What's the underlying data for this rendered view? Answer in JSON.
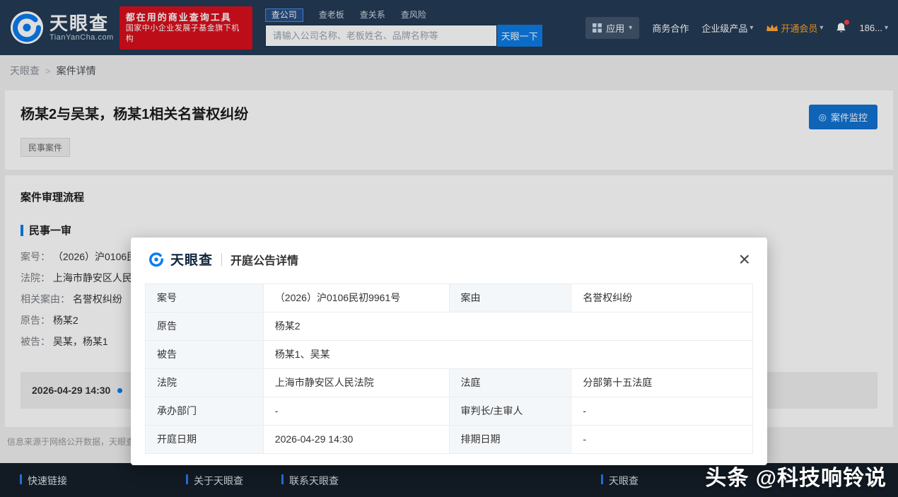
{
  "header": {
    "logo": {
      "brand": "天眼查",
      "domain": "TianYanCha.com"
    },
    "promo_badge": {
      "line1": "都在用的商业查询工具",
      "line2": "国家中小企业发展子基金旗下机构"
    },
    "search_tabs": [
      {
        "label": "查公司",
        "active": true
      },
      {
        "label": "查老板",
        "active": false
      },
      {
        "label": "查关系",
        "active": false
      },
      {
        "label": "查风险",
        "active": false
      }
    ],
    "search": {
      "placeholder": "请输入公司名称、老板姓名、品牌名称等",
      "button_label": "天眼一下"
    },
    "nav": {
      "apps": "应用",
      "business": "商务合作",
      "enterprise": "企业级产品",
      "vip": "开通会员",
      "account": "186..."
    }
  },
  "breadcrumb": {
    "home": "天眼查",
    "separator": ">",
    "current": "案件详情"
  },
  "case": {
    "title": "杨某2与吴某，杨某1相关名誉权纠纷",
    "tag": "民事案件",
    "monitor_button": "案件监控",
    "section_title": "案件审理流程",
    "stage_title": "民事一审",
    "fields": [
      {
        "label": "案号：",
        "value": "（2026）沪0106民"
      },
      {
        "label": "法院：",
        "value": "上海市静安区人民"
      },
      {
        "label": "相关案由：",
        "value": "名誉权纠纷"
      },
      {
        "label": "原告：",
        "value": "杨某2"
      },
      {
        "label": "被告：",
        "value": "吴某，杨某1"
      }
    ],
    "timeline_event": {
      "date": "2026-04-29 14:30"
    },
    "source_note": "信息来源于网络公开数据，天眼查"
  },
  "modal": {
    "brand": "天眼查",
    "title": "开庭公告详情",
    "close_glyph": "×",
    "table": {
      "rows": [
        {
          "label1": "案号",
          "value1": "（2026）沪0106民初9961号",
          "label2": "案由",
          "value2": "名誉权纠纷"
        },
        {
          "label1": "原告",
          "value1": "杨某2"
        },
        {
          "label1": "被告",
          "value1": "杨某1、吴某"
        },
        {
          "label1": "法院",
          "value1": "上海市静安区人民法院",
          "label2": "法庭",
          "value2": "分部第十五法庭"
        },
        {
          "label1": "承办部门",
          "value1": "-",
          "label2": "审判长/主审人",
          "value2": "-"
        },
        {
          "label1": "开庭日期",
          "value1": "2026-04-29 14:30",
          "label2": "排期日期",
          "value2": "-"
        }
      ]
    }
  },
  "footer": {
    "columns": [
      {
        "title": "快速链接"
      },
      {
        "title": "关于天眼查"
      },
      {
        "title": "联系天眼查"
      },
      {
        "title": "天眼查"
      }
    ]
  },
  "watermark": "头条 @科技响铃说",
  "colors": {
    "header_bg": "#243b56",
    "accent_blue": "#0a7cf0",
    "badge_red": "#d9101c",
    "vip_orange": "#ffa524",
    "footer_bg": "#151e29"
  }
}
